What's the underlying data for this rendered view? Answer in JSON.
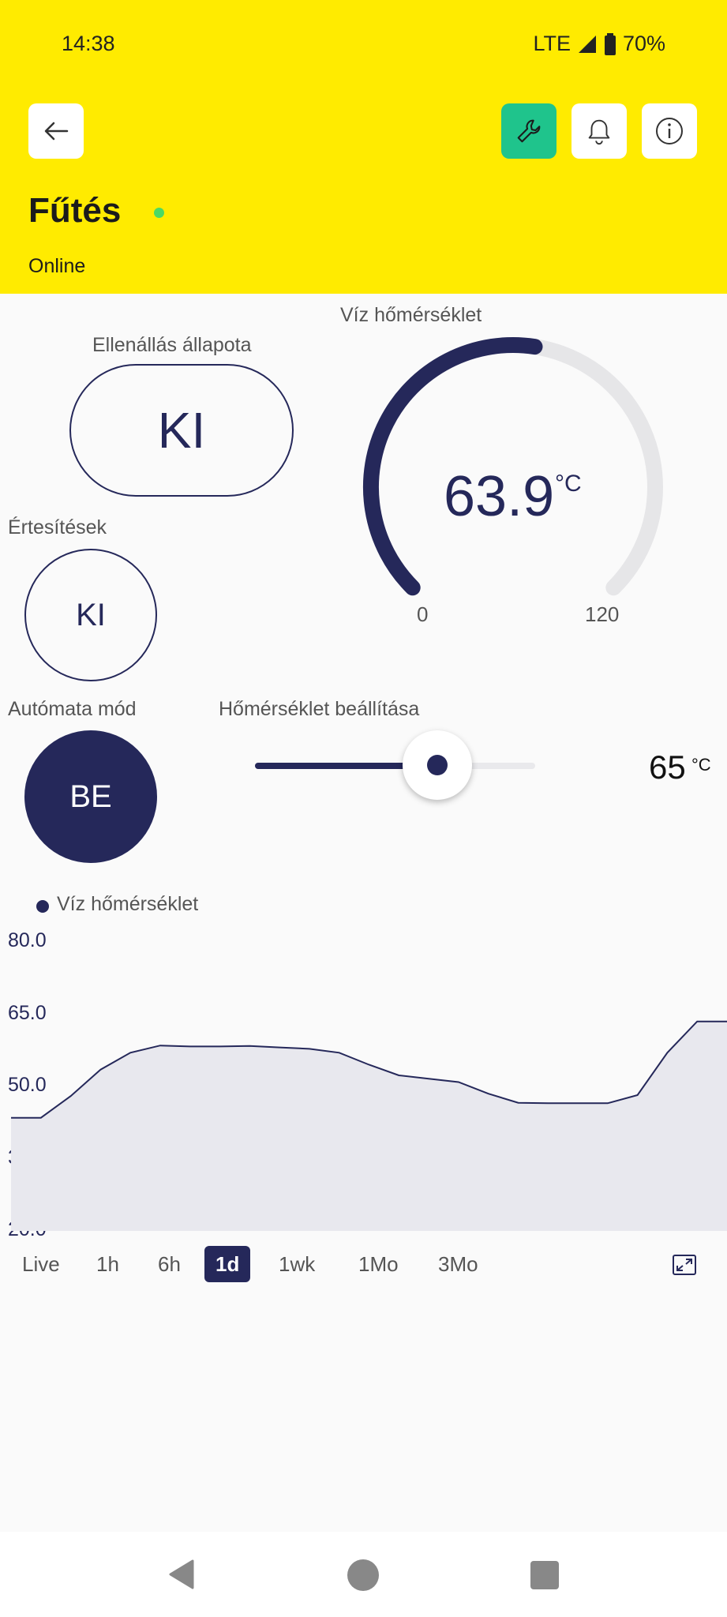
{
  "status_bar": {
    "time": "14:38",
    "network": "LTE",
    "battery": "70%"
  },
  "header": {
    "title": "Fűtés",
    "status": "Online",
    "back_icon": "arrow-left-icon",
    "buttons": [
      {
        "name": "wrench-icon",
        "color": "#1fc48c"
      },
      {
        "name": "bell-icon",
        "color": "#ffffff"
      },
      {
        "name": "info-icon",
        "color": "#ffffff"
      }
    ],
    "online_color": "#4cd964"
  },
  "resistance": {
    "label": "Ellenállás állapota",
    "value": "KI"
  },
  "notifications": {
    "label": "Értesítések",
    "value": "KI"
  },
  "auto_mode": {
    "label": "Autómata mód",
    "value": "BE"
  },
  "gauge": {
    "label": "Víz hőmérséklet",
    "value": "63.9",
    "numeric_value": 63.9,
    "unit": "°C",
    "min": "0",
    "max": "120",
    "min_value": 0,
    "max_value": 120
  },
  "setpoint": {
    "label": "Hőmérséklet beállítása",
    "value": "65",
    "unit": "°C",
    "fraction": 0.65
  },
  "chart_data": {
    "type": "area",
    "legend": "Víz hőmérséklet",
    "yticks": [
      "80.0",
      "65.0",
      "50.0",
      "35.0",
      "20.0"
    ],
    "ylim": [
      20,
      80
    ],
    "series": [
      {
        "name": "Víz hőmérséklet",
        "values": [
          43.5,
          43.5,
          48.0,
          53.5,
          57.0,
          58.5,
          58.3,
          58.3,
          58.4,
          58.1,
          57.8,
          57.0,
          54.5,
          52.3,
          51.6,
          50.9,
          48.5,
          46.6,
          46.5,
          46.5,
          46.5,
          48.2,
          57.0,
          63.5,
          63.5
        ]
      }
    ],
    "grid": false,
    "colors": {
      "line": "#25285a",
      "fill": "#e8e8ee"
    }
  },
  "time_ranges": [
    "Live",
    "1h",
    "6h",
    "1d",
    "1wk",
    "1Mo",
    "3Mo"
  ],
  "active_range": "1d",
  "expand_icon": "expand-icon",
  "nav_bar": {
    "back": "nav-back-icon",
    "home": "nav-home-icon",
    "recents": "nav-recents-icon"
  },
  "colors": {
    "accent": "#25285a",
    "header": "#ffeb00"
  }
}
